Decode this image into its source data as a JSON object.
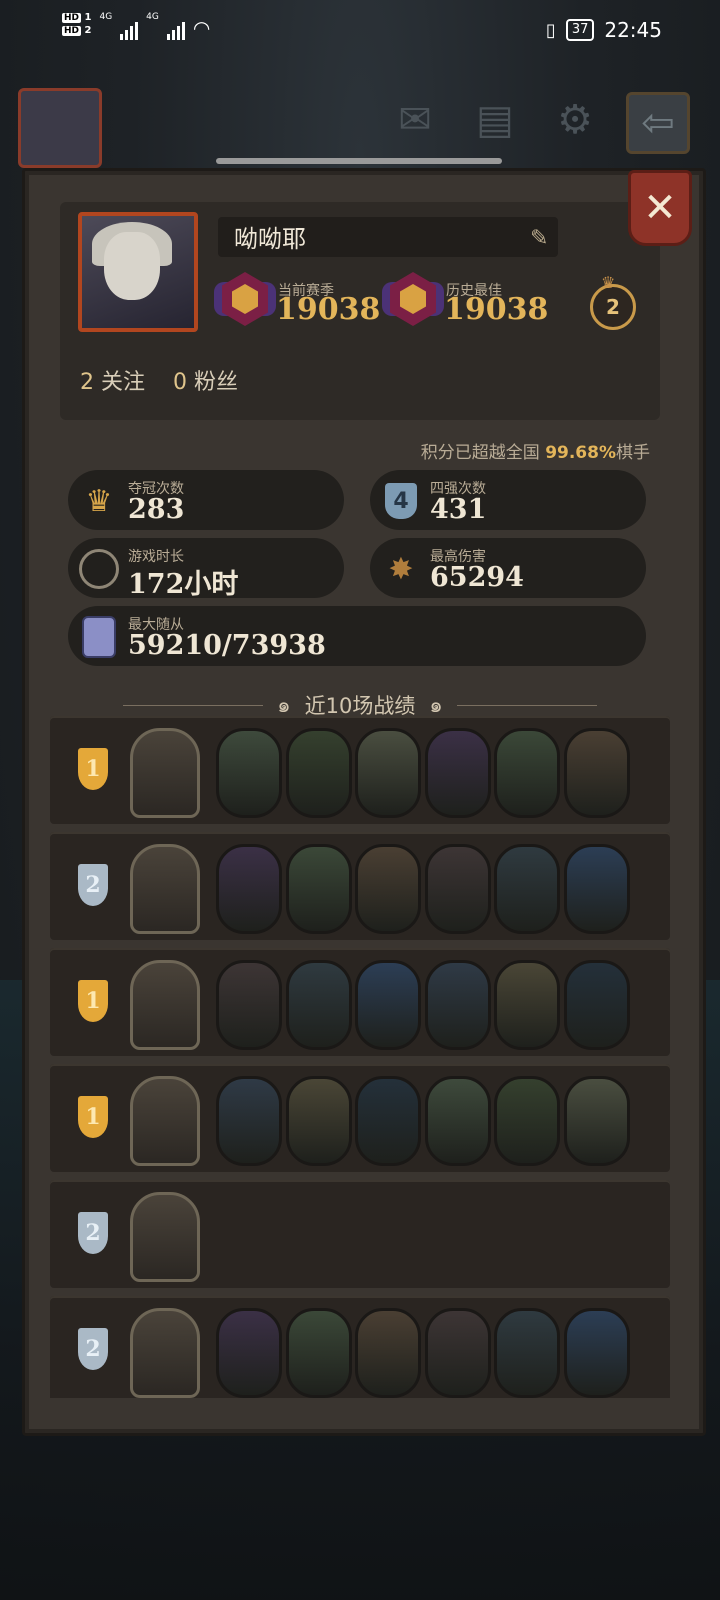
{
  "status_bar": {
    "sim1": "HD",
    "sim1_num": "1",
    "sim2": "HD",
    "sim2_num": "2",
    "net1": "4G",
    "net2": "4G",
    "battery": "37",
    "time": "22:45"
  },
  "topbar": {
    "icons": [
      "mail-icon",
      "notes-icon",
      "gear-icon",
      "exit-icon"
    ]
  },
  "profile": {
    "name": "呦呦耶",
    "season_label": "当前赛季",
    "season_score": "19038",
    "best_label": "历史最佳",
    "best_score": "19038",
    "crown_level": "2",
    "following_count": "2",
    "following_label": "关注",
    "followers_count": "0",
    "followers_label": "粉丝"
  },
  "percent": {
    "prefix": "积分已超越全国",
    "value": "99.68%",
    "suffix": "棋手"
  },
  "stats": {
    "wins_label": "夺冠次数",
    "wins_value": "283",
    "top4_label": "四强次数",
    "top4_value": "431",
    "playtime_label": "游戏时长",
    "playtime_value": "172小时",
    "damage_label": "最高伤害",
    "damage_value": "65294",
    "minions_label": "最大随从",
    "minions_value": "59210/73938",
    "top4_icon_text": "4"
  },
  "recent": {
    "title": "近10场战绩",
    "matches": [
      {
        "place": "1",
        "tier": "gold",
        "minions": 6
      },
      {
        "place": "2",
        "tier": "silver",
        "minions": 6
      },
      {
        "place": "1",
        "tier": "gold",
        "minions": 6
      },
      {
        "place": "1",
        "tier": "gold",
        "minions": 6
      },
      {
        "place": "2",
        "tier": "silver",
        "minions": 0
      },
      {
        "place": "2",
        "tier": "silver",
        "minions": 6
      }
    ]
  },
  "colors": {
    "panel": "#3a3530",
    "accent_gold": "#e3b55a",
    "close_red": "#8e3328"
  }
}
